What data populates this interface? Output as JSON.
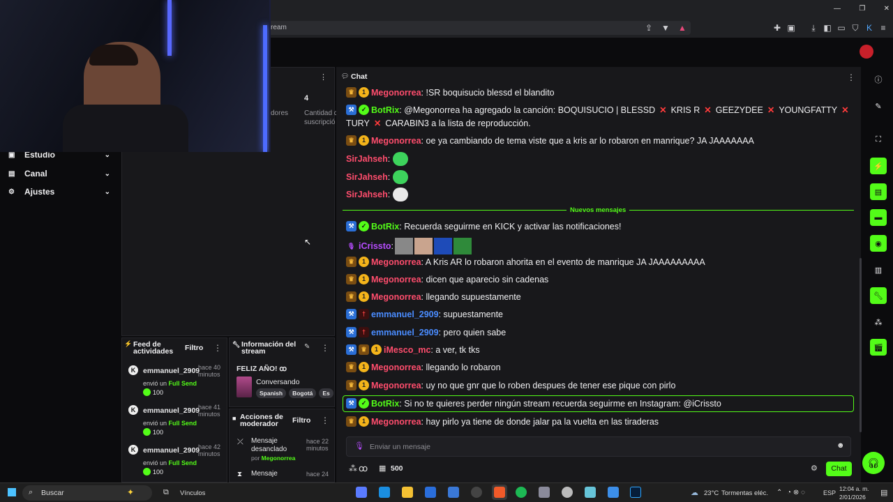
{
  "browser": {
    "url_fragment": "ream",
    "window_controls": [
      "—",
      "❐",
      "✕"
    ]
  },
  "leftnav": {
    "items": [
      {
        "label": "Estudio",
        "icon": "studio-icon"
      },
      {
        "label": "Canal",
        "icon": "channel-icon"
      },
      {
        "label": "Ajustes",
        "icon": "gear-icon"
      }
    ]
  },
  "stats": {
    "partial_label": "dores",
    "value": "4",
    "sub_label_1": "Cantidad d",
    "sub_label_2": "suscripció"
  },
  "feed": {
    "title_1": "Feed de",
    "title_2": "actividades",
    "filter": "Filtro",
    "items": [
      {
        "user": "emmanuel_2909",
        "time_1": "hace 40",
        "time_2": "minutos",
        "action": "envió un",
        "gift": "Full Send",
        "amount": "100"
      },
      {
        "user": "emmanuel_2909",
        "time_1": "hace 41",
        "time_2": "minutos",
        "action": "envió un",
        "gift": "Full Send",
        "amount": "100"
      },
      {
        "user": "emmanuel_2909",
        "time_1": "hace 42",
        "time_2": "minutos",
        "action": "envió un",
        "gift": "Full Send",
        "amount": "100"
      }
    ]
  },
  "info": {
    "title_1": "Información del",
    "title_2": "stream",
    "stream_title": "FELIZ AÑO! ꝏ",
    "category": "Conversando",
    "tags": [
      "Spanish",
      "Bogotá",
      "Es"
    ]
  },
  "modactions": {
    "title_1": "Acciones de",
    "title_2": "moderador",
    "filter": "Filtro",
    "items": [
      {
        "line1": "Mensaje",
        "line2": "desanclado",
        "by": "por",
        "mod": "Megonorrea",
        "time_1": "hace 22",
        "time_2": "minutos"
      },
      {
        "line1": "Mensaje",
        "time_1": "hace 24"
      }
    ]
  },
  "chat": {
    "title": "Chat",
    "new_messages": "Nuevos mensajes",
    "input_placeholder": "Enviar un mensaje",
    "points": "500",
    "infinite": "ꝏ",
    "send": "Chat",
    "messages": [
      {
        "user": "Megonorrea",
        "text": ": !SR boquisucio blessd el blandito"
      },
      {
        "user": "BotRix",
        "text": ": @Megonorrea ha agregado la canción: BOQUISUCIO | BLESSD",
        "parts": [
          "KRIS R",
          "GEEZYDEE",
          "YOUNGFATTY"
        ],
        "line2a": "TURY",
        "line2b": "CARABIN3 a la lista de reproducción."
      },
      {
        "user": "Megonorrea",
        "text": ": oe ya cambiando de tema viste que a kris ar lo robaron en manrique? JA JAAAAAAA"
      },
      {
        "user": "SirJahseh",
        "text": ":"
      },
      {
        "user": "SirJahseh",
        "text": ":"
      },
      {
        "user": "SirJahseh",
        "text": ":"
      },
      {
        "user": "BotRix",
        "text": ": Recuerda seguirme en KICK y activar las notificaciones!"
      },
      {
        "user": "iCrissto",
        "text": ":"
      },
      {
        "user": "Megonorrea",
        "text": ": A Kris AR lo robaron ahorita en el evento de manrique JA JAAAAAAAAA"
      },
      {
        "user": "Megonorrea",
        "text": ": dicen que aparecio sin cadenas"
      },
      {
        "user": "Megonorrea",
        "text": ": llegando supuestamente"
      },
      {
        "user": "emmanuel_2909",
        "text": ": supuestamente"
      },
      {
        "user": "emmanuel_2909",
        "text": ": pero quien sabe"
      },
      {
        "user": "iMesco_mc",
        "text": ": a ver, tk tks"
      },
      {
        "user": "Megonorrea",
        "text": ": llegando lo robaron"
      },
      {
        "user": "Megonorrea",
        "text": ": uy no que gnr que lo roben despues de tener ese pique con pirlo"
      },
      {
        "user": "BotRix",
        "text": ": Si no te quieres perder ningún stream recuerda seguirme en Instagram: @iCrissto"
      },
      {
        "user": "Megonorrea",
        "text": ": hay pirlo ya tiene de donde jalar pa la vuelta en las tiraderas"
      }
    ]
  },
  "taskbar": {
    "search": "Buscar",
    "links": "Vínculos",
    "weather_temp": "23°C",
    "weather_text": "Tormentas eléc.",
    "lang": "ESP",
    "time": "12:04 a. m.",
    "date": "2/01/2026"
  },
  "colors": {
    "kick_green": "#53fc18",
    "chat_bg": "#18181b",
    "username_red": "#ff4d6d"
  }
}
